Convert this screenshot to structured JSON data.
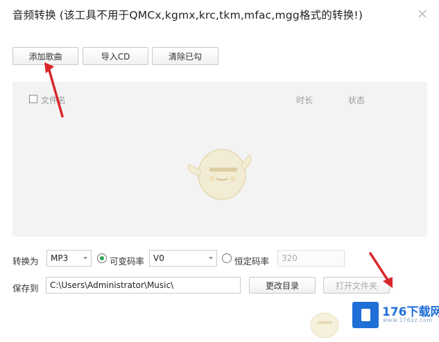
{
  "window": {
    "title": "音频转换 (该工具不用于QMCx,kgmx,krc,tkm,mfac,mgg格式的转换!)"
  },
  "toolbar": {
    "add_songs": "添加歌曲",
    "import_cd": "导入CD",
    "clear_checked": "清除已勾"
  },
  "list": {
    "columns": {
      "filename": "文件名",
      "duration": "时长",
      "status": "状态"
    },
    "checked": false
  },
  "convert": {
    "label": "转换为",
    "format": "MP3",
    "vbr_label": "可变码率",
    "vbr_selected": true,
    "vbr_value": "V0",
    "cbr_label": "恒定码率",
    "cbr_selected": false,
    "cbr_value": "320"
  },
  "save": {
    "label": "保存到",
    "path": "C:\\Users\\Administrator\\Music\\",
    "change_dir": "更改目录",
    "open_folder": "打开文件夹"
  },
  "watermark": {
    "brand": "176下载网",
    "url": "www.176xz.com"
  },
  "colors": {
    "annotation_arrow": "#d9262b",
    "radio_selected": "#2aa44f",
    "watermark": "#1f6fd6"
  }
}
